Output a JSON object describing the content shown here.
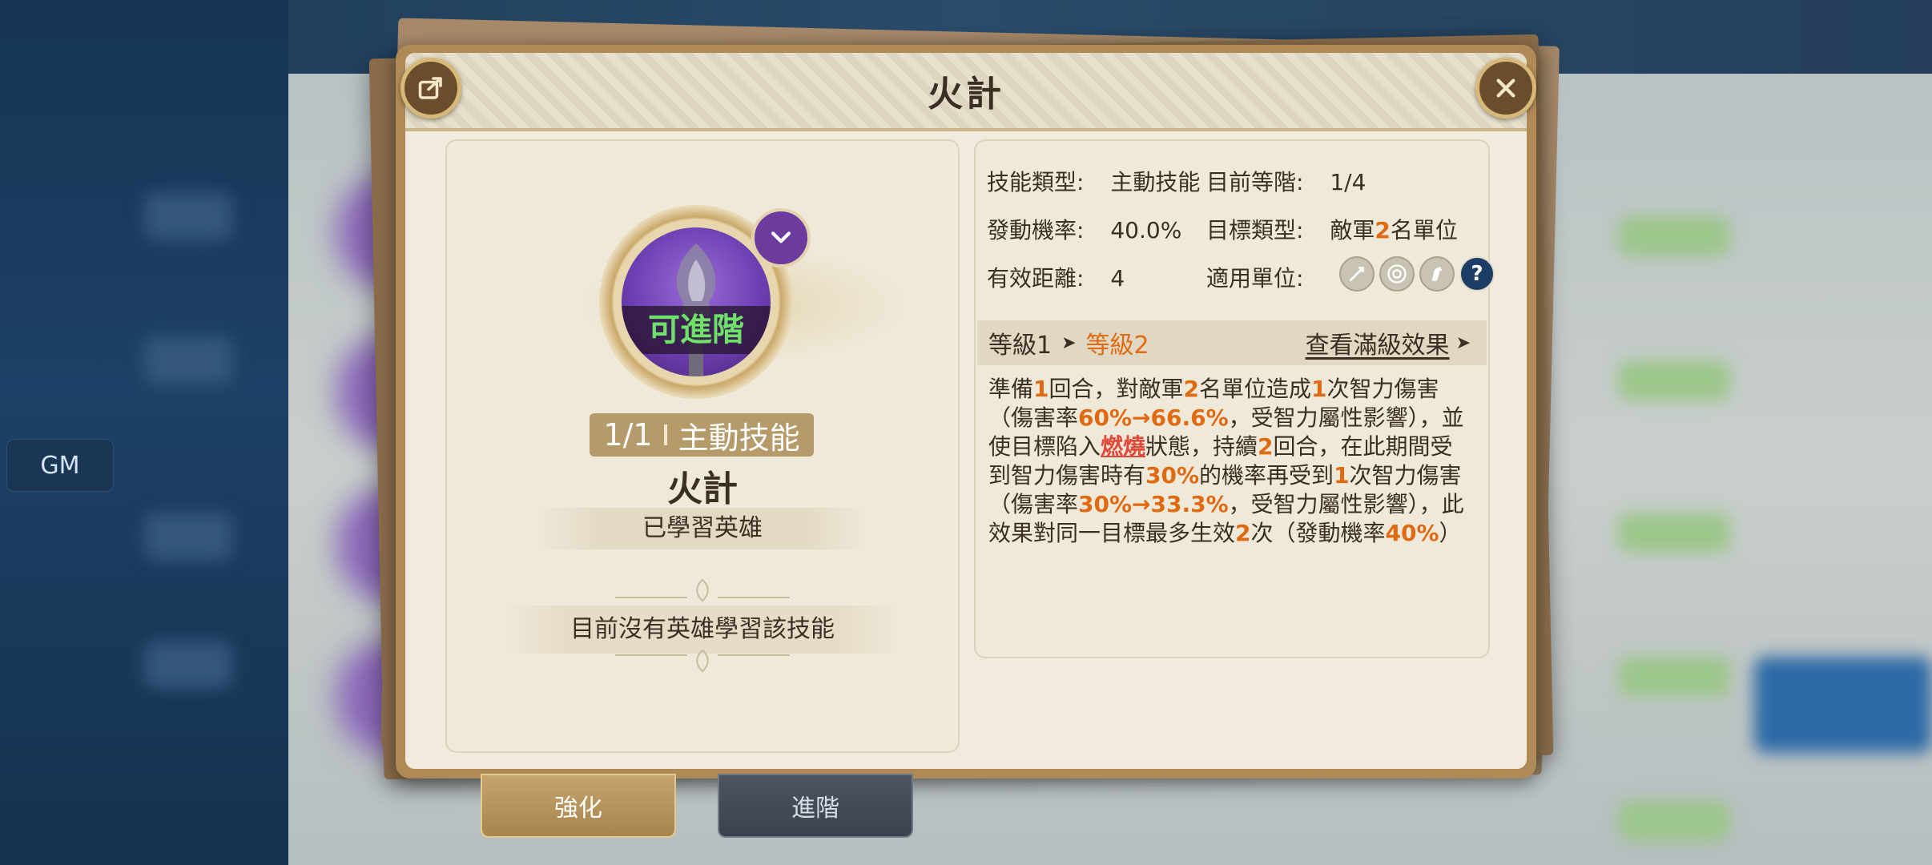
{
  "gm_label": "GM",
  "dialog": {
    "title": "火計",
    "share_icon": "share-icon",
    "close_icon": "close-icon"
  },
  "skill_card": {
    "upgrade_badge": "可進階",
    "tag_count": "1/1",
    "tag_type": "主動技能",
    "name": "火計",
    "learned_heading": "已學習英雄",
    "no_hero_text": "目前沒有英雄學習該技能"
  },
  "info": {
    "type_label": "技能類型:",
    "type_value": "主動技能",
    "grade_label": "目前等階:",
    "grade_value": "1/4",
    "chance_label": "發動機率:",
    "chance_value": "40.0%",
    "target_label": "目標類型:",
    "target_prefix": "敵軍",
    "target_count": "2",
    "target_suffix": "名單位",
    "range_label": "有效距離:",
    "range_value": "4",
    "units_label": "適用單位:",
    "unit_icons": [
      "sword-icon",
      "bow-target-icon",
      "horse-icon",
      "question-icon"
    ],
    "unit_q": "?"
  },
  "level": {
    "current": "等級1",
    "next": "等級2",
    "view_max": "查看滿級效果"
  },
  "description": {
    "p1": "準備",
    "n1": "1",
    "p2": "回合，對敵軍",
    "n2": "2",
    "p3": "名單位造成",
    "n3": "1",
    "p4": "次智力傷害（傷害率",
    "n4": "60%→66.6%",
    "p5": "，受智力屬性影響），並使目標陷入",
    "burn": "燃燒",
    "p6": "狀態，持續",
    "n5": "2",
    "p7": "回合，在此期間受到智力傷害時有",
    "n6": "30%",
    "p8": "的機率再受到",
    "n7": "1",
    "p9": "次智力傷害（傷害率",
    "n8": "30%→33.3%",
    "p10": "，受智力屬性影響），此效果對同一目標最多生效",
    "n9": "2",
    "p11": "次（發動機率",
    "n10": "40%",
    "p12": "）"
  },
  "tabs": {
    "strengthen": "強化",
    "advance": "進階"
  },
  "colors": {
    "accent_orange": "#e06a12",
    "upgrade_green": "#6fe06a",
    "burn_red": "#e04a3a"
  }
}
